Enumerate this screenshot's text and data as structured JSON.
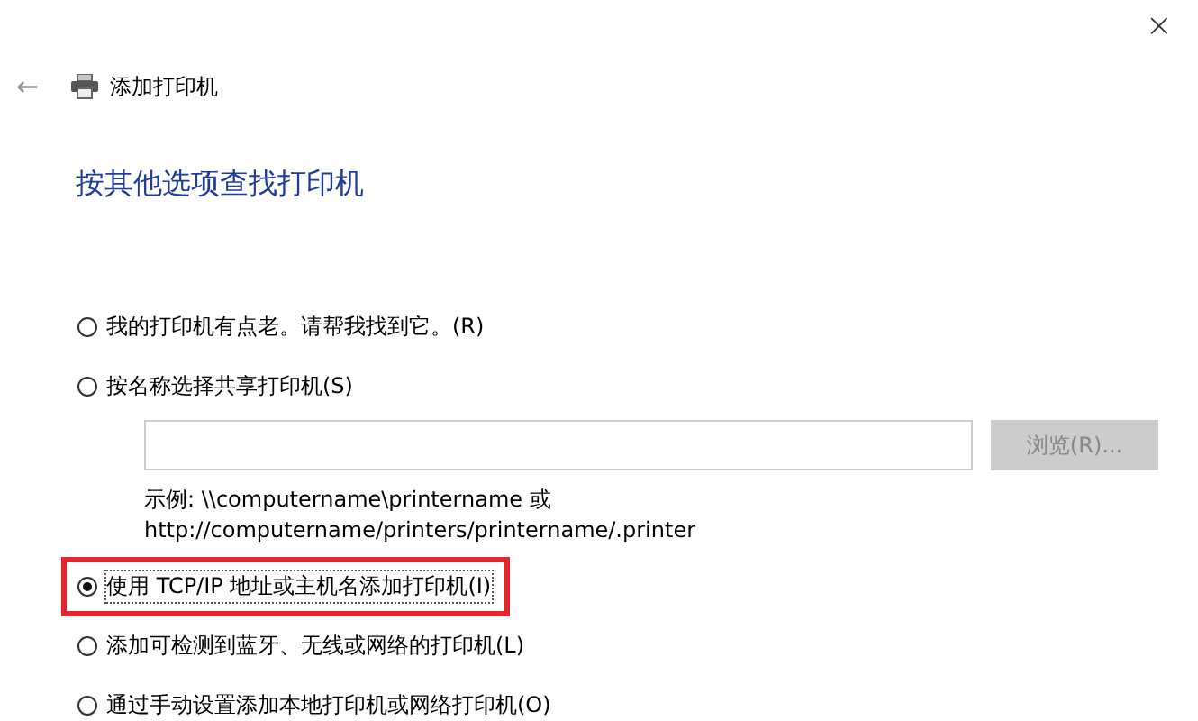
{
  "window": {
    "close": "×",
    "back": "←",
    "title": "添加打印机"
  },
  "heading": "按其他选项查找打印机",
  "options": [
    {
      "kind": "radio",
      "label": "我的打印机有点老。请帮我找到它。(R)",
      "selected": false,
      "highlighted": false
    },
    {
      "kind": "share",
      "label": "按名称选择共享打印机(S)",
      "selected": false,
      "highlighted": false,
      "browse": {
        "label": "浏览(R)...",
        "disabled": true
      },
      "example": [
        "示例: \\\\computername\\printername 或",
        "http://computername/printers/printername/.printer"
      ]
    },
    {
      "kind": "radio",
      "label": "使用 TCP/IP 地址或主机名添加打印机(I)",
      "selected": true,
      "highlighted": true
    },
    {
      "kind": "radio",
      "label": "添加可检测到蓝牙、无线或网络的打印机(L)",
      "selected": false,
      "highlighted": false
    },
    {
      "kind": "radio",
      "label": "通过手动设置添加本地打印机或网络打印机(O)",
      "selected": false,
      "highlighted": false
    }
  ]
}
